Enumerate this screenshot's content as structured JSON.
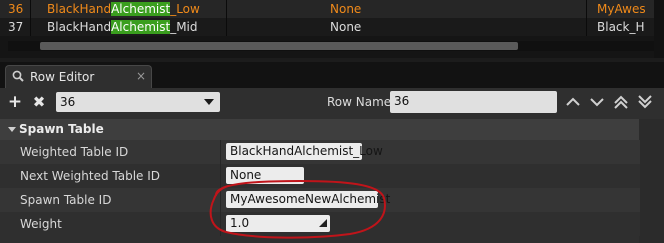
{
  "table": {
    "rows": [
      {
        "index": "36",
        "name_prefix": "BlackHand",
        "name_highlight": "Alchemist",
        "name_suffix": "_Low",
        "col2": "None",
        "col3": "MyAwes"
      },
      {
        "index": "37",
        "name_prefix": "BlackHand",
        "name_highlight": "Alchemist",
        "name_suffix": "_Mid",
        "col2": "None",
        "col3": "Black_H"
      }
    ],
    "highlight_color": "#3a9e1e",
    "selected_text_color": "#f08a1a"
  },
  "tab": {
    "label": "Row Editor",
    "icon": "magnifier-icon",
    "close": "×"
  },
  "toolbar": {
    "add_icon": "+",
    "remove_icon": "✖",
    "row_select_value": "36",
    "row_name_label": "Row Name:",
    "row_name_value": "36"
  },
  "section": {
    "title": "Spawn Table"
  },
  "properties": [
    {
      "label": "Weighted Table ID",
      "value": "BlackHandAlchemist_Low"
    },
    {
      "label": "Next Weighted Table ID",
      "value": "None"
    },
    {
      "label": "Spawn Table ID",
      "value": "MyAwesomeNewAlchemist"
    },
    {
      "label": "Weight",
      "value": "1.0"
    }
  ],
  "annotation_color": "#c0141a"
}
